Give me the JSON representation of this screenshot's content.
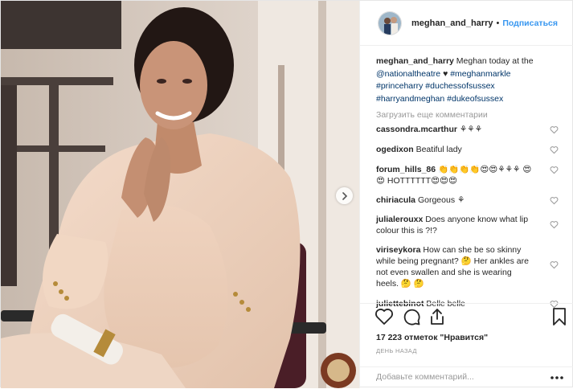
{
  "post": {
    "username": "meghan_and_harry",
    "separator": "•",
    "follow_label": "Подписаться",
    "caption": {
      "username": "meghan_and_harry",
      "text_before": "Meghan today at the",
      "mention": "@nationaltheatre",
      "heart": "♥",
      "hashtags": [
        "#meghanmarkle",
        "#princeharry",
        "#duchessofsussex",
        "#harryandmeghan",
        "#dukeofsussex"
      ]
    },
    "load_more_label": "Загрузить еще комментарии",
    "comments": [
      {
        "user": "cassondra.mcarthur",
        "text": "⚘⚘⚘"
      },
      {
        "user": "ogedixon",
        "text": "Beatiful lady"
      },
      {
        "user": "forum_hills_86",
        "text": "👏👏👏👏😍😍⚘⚘⚘ 😍😍 HOTTTTTT😍😍😍"
      },
      {
        "user": "chiriacula",
        "text": "Gorgeous ⚘"
      },
      {
        "user": "julialerouxx",
        "text": "Does anyone know what lip colour this is ?!?"
      },
      {
        "user": "viriseykora",
        "text": "How can she be so skinny while being pregnant? 🤔 Her ankles are not even swallen and she is wearing heels. 🤔 🤔"
      },
      {
        "user": "juliettebinot",
        "text": "Belle belle"
      }
    ],
    "likes_label": "17 223 отметок \"Нравится\"",
    "time_label": "ДЕНЬ НАЗАД",
    "add_comment_placeholder": "Добавьте комментарий...",
    "icons": {
      "like": "heart-icon",
      "comment": "comment-icon",
      "share": "share-icon",
      "save": "bookmark-icon",
      "more": "more-options-icon",
      "next": "chevron-right-icon",
      "comment_like": "heart-icon"
    },
    "colors": {
      "link": "#003569",
      "follow": "#3897f0",
      "muted": "#999999",
      "text": "#262626"
    }
  }
}
